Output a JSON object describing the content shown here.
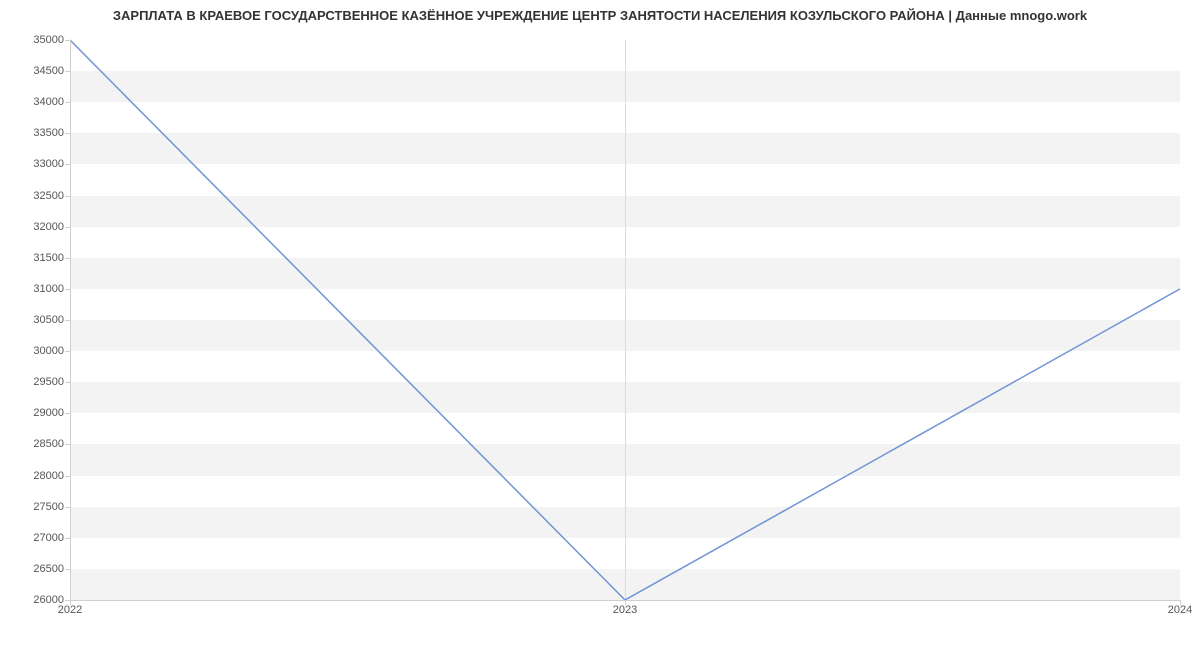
{
  "chart_data": {
    "type": "line",
    "title": "ЗАРПЛАТА В КРАЕВОЕ ГОСУДАРСТВЕННОЕ КАЗЁННОЕ УЧРЕЖДЕНИЕ ЦЕНТР ЗАНЯТОСТИ НАСЕЛЕНИЯ КОЗУЛЬСКОГО РАЙОНА | Данные mnogo.work",
    "xlabel": "",
    "ylabel": "",
    "categories": [
      "2022",
      "2023",
      "2024"
    ],
    "values": [
      35000,
      26000,
      31000
    ],
    "ylim": [
      26000,
      35000
    ],
    "yticks": [
      26000,
      26500,
      27000,
      27500,
      28000,
      28500,
      29000,
      29500,
      30000,
      30500,
      31000,
      31500,
      32000,
      32500,
      33000,
      33500,
      34000,
      34500,
      35000
    ],
    "grid_on": true,
    "legend": "none"
  }
}
